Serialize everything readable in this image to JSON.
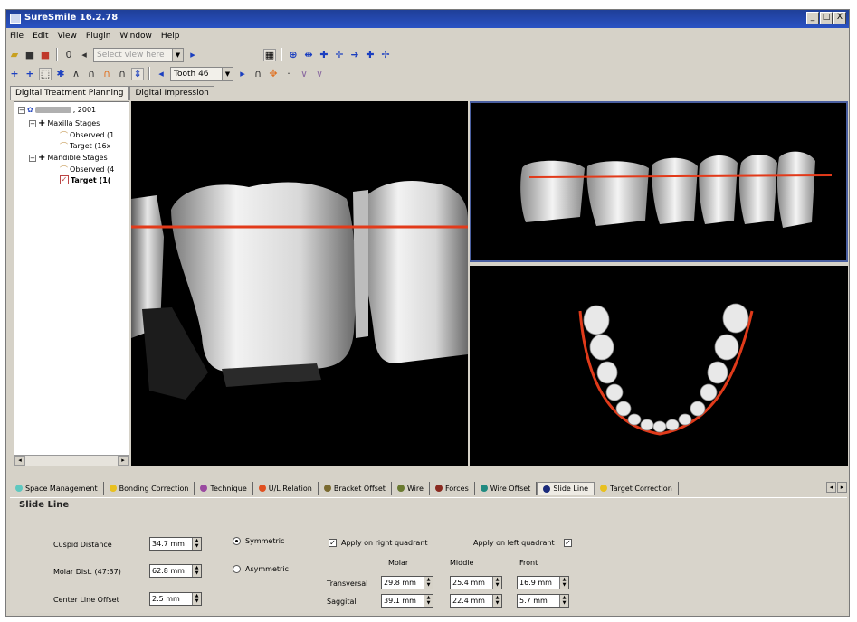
{
  "window": {
    "title": "SureSmile 16.2.78",
    "min_glyph": "_",
    "max_glyph": "□",
    "close_glyph": "X"
  },
  "menu": [
    "File",
    "Edit",
    "View",
    "Plugin",
    "Window",
    "Help"
  ],
  "toolbar": {
    "tooth_select": "Tooth 46",
    "disabled_combo": "Select view here"
  },
  "main_tabs": [
    "Digital Treatment Planning",
    "Digital Impression"
  ],
  "tree": {
    "root_year": ", 2001",
    "maxilla": "Maxilla Stages",
    "maxilla_observed": "Observed (1",
    "maxilla_target": "Target (16x",
    "mandible": "Mandible Stages",
    "mandible_observed": "Observed (4",
    "mandible_target": "Target (1("
  },
  "bottom_tabs": [
    {
      "label": "Space Management",
      "color": "#5fc8c0"
    },
    {
      "label": "Bonding Correction",
      "color": "#e8c020"
    },
    {
      "label": "Technique",
      "color": "#9a4aa0"
    },
    {
      "label": "U/L Relation",
      "color": "#e05020"
    },
    {
      "label": "Bracket Offset",
      "color": "#7a6a30"
    },
    {
      "label": "Wire",
      "color": "#6a7a30"
    },
    {
      "label": "Forces",
      "color": "#8a2a20"
    },
    {
      "label": "Wire Offset",
      "color": "#208a80"
    },
    {
      "label": "Slide Line",
      "color": "#1a2a7a",
      "active": true
    },
    {
      "label": "Target Correction",
      "color": "#e8c020"
    }
  ],
  "slide_line": {
    "title": "Slide Line",
    "cuspid_distance_label": "Cuspid Distance",
    "cuspid_distance": "34.7 mm",
    "molar_dist_label": "Molar Dist. (47:37)",
    "molar_dist": "62.8 mm",
    "center_line_label": "Center Line Offset",
    "center_line": "2.5 mm",
    "symmetric": "Symmetric",
    "asymmetric": "Asymmetric",
    "apply_right": "Apply on right quadrant",
    "apply_left": "Apply on left quadrant",
    "col_molar": "Molar",
    "col_middle": "Middle",
    "col_front": "Front",
    "row_transversal": "Transversal",
    "row_sagittal": "Saggital",
    "trans_molar": "29.8 mm",
    "trans_middle": "25.4 mm",
    "trans_front": "16.9 mm",
    "sag_molar": "39.1 mm",
    "sag_middle": "22.4 mm",
    "sag_front": "5.7 mm"
  }
}
